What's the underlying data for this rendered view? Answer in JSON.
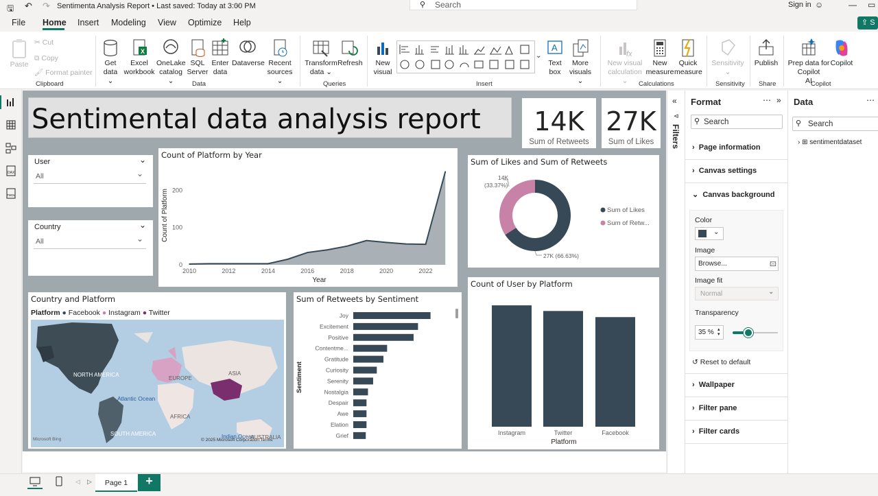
{
  "titlebar": {
    "title": "Sentimenta Analysis Report • Last saved: Today at 3:00 PM",
    "search_placeholder": "Search",
    "sign_in": "Sign in"
  },
  "menu": {
    "tabs": [
      "File",
      "Home",
      "Insert",
      "Modeling",
      "View",
      "Optimize",
      "Help"
    ],
    "active": "Home",
    "share_label": "S"
  },
  "ribbon": {
    "clipboard": {
      "paste": "Paste",
      "cut": "Cut",
      "copy": "Copy",
      "format_painter": "Format painter",
      "group": "Clipboard"
    },
    "data": {
      "get_data": [
        "Get",
        "data ⌄"
      ],
      "excel": [
        "Excel",
        "workbook"
      ],
      "onelake": [
        "OneLake",
        "catalog ⌄"
      ],
      "sql": [
        "SQL",
        "Server"
      ],
      "enter": [
        "Enter",
        "data"
      ],
      "dataverse": [
        "Dataverse",
        ""
      ],
      "recent": [
        "Recent",
        "sources ⌄"
      ],
      "group": "Data"
    },
    "queries": {
      "transform": [
        "Transform",
        "data ⌄"
      ],
      "refresh": [
        "Refresh",
        ""
      ],
      "group": "Queries"
    },
    "insert": {
      "new_visual": [
        "New",
        "visual"
      ],
      "text_box": [
        "Text",
        "box"
      ],
      "more_visuals": [
        "More",
        "visuals ⌄"
      ],
      "group": "Insert"
    },
    "calculations": {
      "new_visual_calc": [
        "New visual",
        "calculation ⌄"
      ],
      "new_measure": [
        "New",
        "measure"
      ],
      "quick_measure": [
        "Quick",
        "measure"
      ],
      "group": "Calculations"
    },
    "sensitivity": {
      "label": [
        "Sensitivity",
        "⌄"
      ],
      "group": "Sensitivity"
    },
    "share": {
      "publish": [
        "Publish",
        ""
      ],
      "group": "Share"
    },
    "copilot": {
      "prep": [
        "Prep data for Copilot",
        "AI"
      ],
      "copilot": [
        "Copilot",
        ""
      ],
      "group": "Copilot"
    }
  },
  "report": {
    "title": "Sentimental data analysis report",
    "card_retweets": {
      "value": "14K",
      "label": "Sum of Retweets"
    },
    "card_likes": {
      "value": "27K",
      "label": "Sum of Likes"
    },
    "slicer_user": {
      "title": "User",
      "value": "All"
    },
    "slicer_country": {
      "title": "Country",
      "value": "All"
    },
    "line_title": "Count of Platform by Year",
    "donut_title": "Sum of Likes and Sum of Retweets",
    "map_title": "Country and Platform",
    "map_legend": {
      "label": "Platform",
      "items": [
        "Facebook",
        "Instagram",
        "Twitter"
      ]
    },
    "map_labels": [
      "NORTH AMERICA",
      "EUROPE",
      "ASIA",
      "Atlantic Ocean",
      "AFRICA",
      "SOUTH AMERICA",
      "Indian Ocean",
      "AUSTRALIA"
    ],
    "map_copyright": "© 2025 Microsoft Corporation  Terms",
    "map_brand": "Microsoft Bing",
    "hbar_title": "Sum of Retweets by Sentiment",
    "vbar_title": "Count of User by Platform"
  },
  "chart_data": [
    {
      "type": "area",
      "title": "Count of Platform by Year",
      "xlabel": "Year",
      "ylabel": "Count of Platform",
      "x": [
        2010,
        2011,
        2012,
        2013,
        2014,
        2015,
        2016,
        2017,
        2018,
        2019,
        2020,
        2021,
        2022,
        2023
      ],
      "values": [
        2,
        3,
        3,
        3,
        3,
        15,
        33,
        40,
        50,
        65,
        60,
        56,
        55,
        250
      ],
      "xticks": [
        2010,
        2012,
        2014,
        2016,
        2018,
        2020,
        2022
      ],
      "yticks": [
        0,
        100,
        200
      ],
      "ylim": [
        0,
        265
      ],
      "xlim": [
        2010,
        2023.2
      ],
      "color": "#374957"
    },
    {
      "type": "pie",
      "title": "Sum of Likes and Sum of Retweets",
      "donut": true,
      "categories": [
        "Sum of Likes",
        "Sum of Retweets"
      ],
      "values": [
        27000,
        14000
      ],
      "percent_labels": [
        "27K (66.63%)",
        "14K (33.37%)"
      ],
      "legend_labels": [
        "Sum of Likes",
        "Sum of Retw..."
      ],
      "colors": [
        "#374957",
        "#c882a8"
      ],
      "legend": "right"
    },
    {
      "type": "bar",
      "orientation": "horizontal",
      "title": "Sum of Retweets by Sentiment",
      "ylabel": "Sentiment",
      "categories": [
        "Joy",
        "Excitement",
        "Positive",
        "Contentme...",
        "Gratitude",
        "Curiosity",
        "Serenity",
        "Nostalgia",
        "Despair",
        "Awe",
        "Elation",
        "Grief"
      ],
      "values": [
        1050,
        880,
        820,
        460,
        410,
        320,
        270,
        200,
        180,
        180,
        180,
        170
      ],
      "xlim": [
        0,
        1100
      ],
      "color": "#374957"
    },
    {
      "type": "bar",
      "title": "Count of User by Platform",
      "xlabel": "Platform",
      "categories": [
        "Instagram",
        "Twitter",
        "Facebook"
      ],
      "values": [
        258,
        246,
        233
      ],
      "ylim": [
        0,
        280
      ],
      "color": "#374957"
    }
  ],
  "filters_label": "Filters",
  "format_pane": {
    "title": "Format",
    "search": "Search",
    "sections": [
      "Page information",
      "Canvas settings",
      "Canvas background"
    ],
    "color_label": "Color",
    "image_label": "Image",
    "browse": "Browse...",
    "image_fit_label": "Image fit",
    "image_fit_value": "Normal",
    "transparency_label": "Transparency",
    "transparency_value": "35 %",
    "transparency": 0.35,
    "reset": "Reset to default",
    "bottom_sections": [
      "Wallpaper",
      "Filter pane",
      "Filter cards"
    ]
  },
  "data_pane": {
    "title": "Data",
    "search": "Search",
    "table": "sentimentdataset"
  },
  "pages": {
    "current": "Page 1",
    "add": "+"
  }
}
